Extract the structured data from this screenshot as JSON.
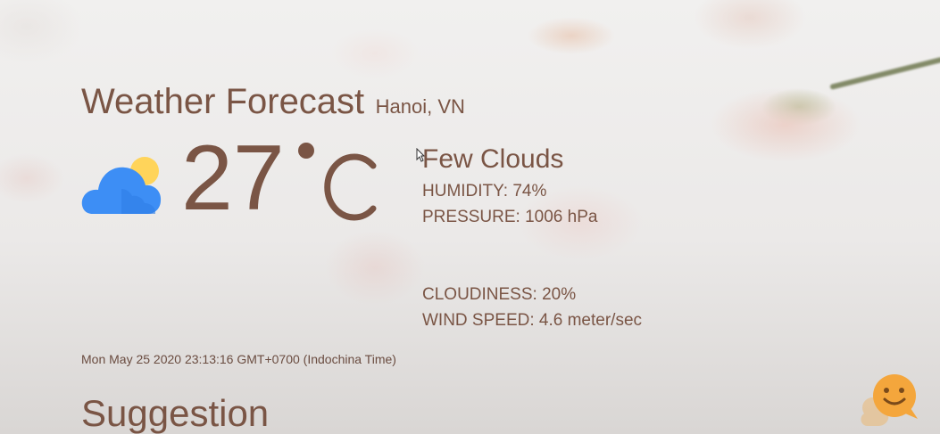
{
  "header": {
    "title": "Weather Forecast",
    "location": "Hanoi, VN"
  },
  "current": {
    "icon": "cloud-sun-icon",
    "temperature": "27",
    "unit": "°C",
    "description": "Few Clouds",
    "humidity": "HUMIDITY: 74%",
    "pressure": "PRESSURE: 1006 hPa",
    "cloudiness": "CLOUDINESS: 20%",
    "wind_speed": "WIND SPEED: 4.6 meter/sec"
  },
  "timestamp": "Mon May 25 2020 23:13:16 GMT+0700 (Indochina Time)",
  "sections": {
    "suggestion_title": "Suggestion"
  },
  "widgets": {
    "chat_icon": "smiley-chat-icon"
  },
  "colors": {
    "text": "#7a5545",
    "cloud_blue": "#3d8ef5",
    "cloud_blue_light": "#5aa6ff",
    "sun_yellow": "#ffd45a",
    "chat_orange": "#f4a63c"
  }
}
